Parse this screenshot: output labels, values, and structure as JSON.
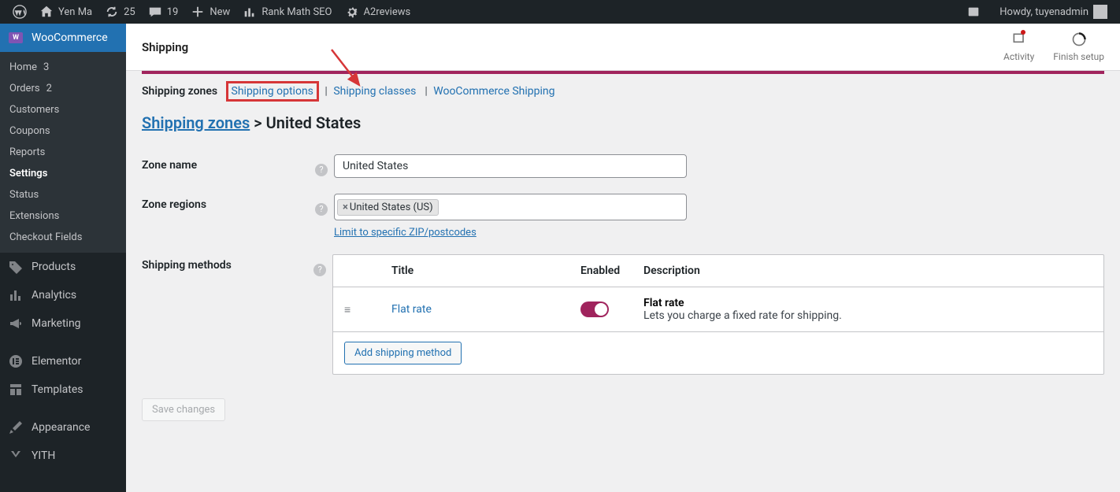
{
  "adminbar": {
    "site_name": "Yen Ma",
    "updates": "25",
    "comments": "19",
    "new_label": "New",
    "rankmath_label": "Rank Math SEO",
    "a2reviews_label": "A2reviews",
    "howdy": "Howdy, tuyenadmin"
  },
  "sidebar": {
    "nav": {
      "woocommerce": "WooCommerce",
      "products": "Products",
      "analytics": "Analytics",
      "marketing": "Marketing",
      "elementor": "Elementor",
      "templates": "Templates",
      "appearance": "Appearance",
      "yith": "YITH"
    },
    "sub": {
      "home": "Home",
      "home_badge": "3",
      "orders": "Orders",
      "orders_badge": "2",
      "customers": "Customers",
      "coupons": "Coupons",
      "reports": "Reports",
      "settings": "Settings",
      "status": "Status",
      "extensions": "Extensions",
      "checkout_fields": "Checkout Fields"
    }
  },
  "topbar": {
    "title": "Shipping",
    "activity": "Activity",
    "finish": "Finish setup"
  },
  "subnav": {
    "zones": "Shipping zones",
    "options": "Shipping options",
    "classes": "Shipping classes",
    "wc_shipping": "WooCommerce Shipping"
  },
  "breadcrumb": {
    "root": "Shipping zones",
    "sep": ">",
    "current": "United States"
  },
  "form": {
    "zone_name_label": "Zone name",
    "zone_name_value": "United States",
    "zone_regions_label": "Zone regions",
    "zone_region_tag": "United States (US)",
    "limit_link": "Limit to specific ZIP/postcodes",
    "methods_label": "Shipping methods"
  },
  "table": {
    "th_title": "Title",
    "th_enabled": "Enabled",
    "th_desc": "Description",
    "row_method_link": "Flat rate",
    "row_desc_title": "Flat rate",
    "row_desc_sub": "Lets you charge a fixed rate for shipping.",
    "add_method": "Add shipping method"
  },
  "save_button": "Save changes"
}
